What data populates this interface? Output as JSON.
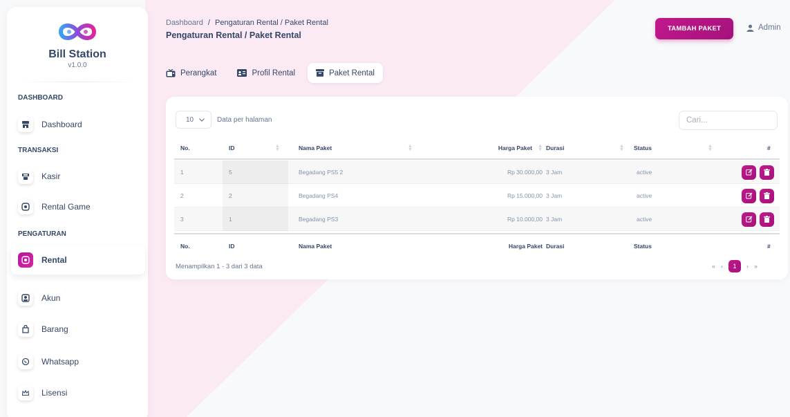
{
  "brand": {
    "name": "Bill Station",
    "version": "v1.0.0"
  },
  "sidebar": {
    "sections": [
      {
        "title": "DASHBOARD"
      },
      {
        "title": "TRANSAKSI"
      },
      {
        "title": "PENGATURAN"
      }
    ],
    "items": [
      {
        "label": "Dashboard",
        "icon": "store-icon"
      },
      {
        "label": "Kasir",
        "icon": "cashier-icon"
      },
      {
        "label": "Rental Game",
        "icon": "gamepad-icon"
      },
      {
        "label": "Rental",
        "icon": "gamepad-icon",
        "active": true
      },
      {
        "label": "Akun",
        "icon": "user-icon"
      },
      {
        "label": "Barang",
        "icon": "bag-icon"
      },
      {
        "label": "Whatsapp",
        "icon": "whatsapp-icon"
      },
      {
        "label": "Lisensi",
        "icon": "crown-icon"
      }
    ]
  },
  "header": {
    "breadcrumb_root": "Dashboard",
    "breadcrumb_sep": "/",
    "breadcrumb_current": "Pengaturan Rental / Paket Rental",
    "title": "Pengaturan Rental / Paket Rental",
    "add_button": "TAMBAH PAKET",
    "user": "Admin"
  },
  "tabs": [
    {
      "label": "Perangkat",
      "icon": "tv-icon"
    },
    {
      "label": "Profil Rental",
      "icon": "id-card-icon"
    },
    {
      "label": "Paket Rental",
      "icon": "archive-icon",
      "active": true
    }
  ],
  "table": {
    "per_page_value": "10",
    "per_page_label": "Data per halaman",
    "search_placeholder": "Cari...",
    "columns": [
      "No.",
      "ID",
      "Nama Paket",
      "Harga Paket",
      "Durasi",
      "Status",
      "#"
    ],
    "rows": [
      {
        "no": "1",
        "id": "5",
        "nama": "Begadang PS5 2",
        "harga": "Rp 30.000,00",
        "durasi": "3 Jam",
        "status": "active"
      },
      {
        "no": "2",
        "id": "2",
        "nama": "Begadang PS4",
        "harga": "Rp 15.000,00",
        "durasi": "3 Jam",
        "status": "active"
      },
      {
        "no": "3",
        "id": "1",
        "nama": "Begadang PS3",
        "harga": "Rp 10.000,00",
        "durasi": "3 Jam",
        "status": "active"
      }
    ],
    "info": "Menampilkan 1 - 3 dari 3 data",
    "pager": {
      "first": "«",
      "prev": "‹",
      "current": "1",
      "next": "›",
      "last": "»"
    }
  },
  "colors": {
    "accent": "#c2188c",
    "text": "#344767",
    "muted": "#67748e",
    "bg_tint": "#fbe7f4"
  }
}
